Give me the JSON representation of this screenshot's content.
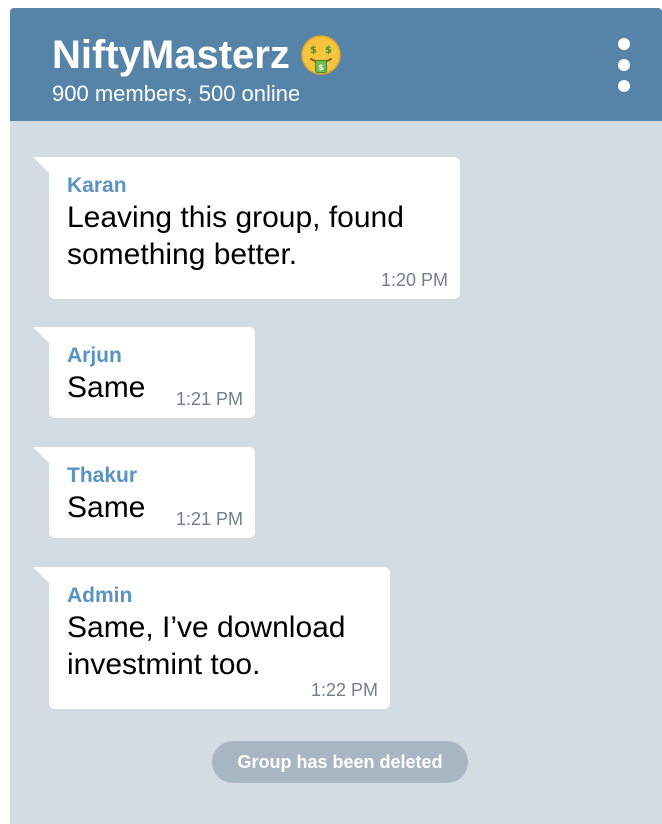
{
  "header": {
    "title": "NiftyMasterz",
    "title_emoji": "money-mouth-face-icon",
    "subtitle": "900 members, 500 online"
  },
  "messages": [
    {
      "sender": "Karan",
      "text": "Leaving this group, found\nsomething better.",
      "time": "1:20 PM"
    },
    {
      "sender": "Arjun",
      "text": "Same",
      "time": "1:21 PM"
    },
    {
      "sender": "Thakur",
      "text": "Same",
      "time": "1:21 PM"
    },
    {
      "sender": "Admin",
      "text": "Same, I’ve download\ninvestmint too.",
      "time": "1:22 PM"
    }
  ],
  "service_message": "Group has been deleted",
  "colors": {
    "header_bg": "#5683a8",
    "chat_bg": "#d3dbe3",
    "sender_name": "#5a93c4",
    "timestamp": "#707f8c",
    "service_pill": "#a8b6c3"
  }
}
